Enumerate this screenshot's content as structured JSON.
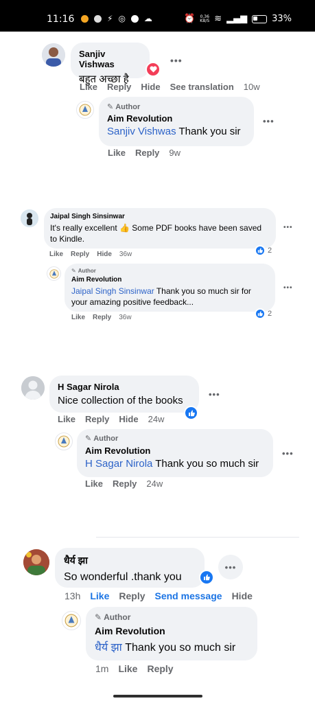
{
  "status_bar": {
    "time": "11:16",
    "net_speed_value": "0.36",
    "net_speed_unit": "KB/S",
    "battery": "33%"
  },
  "comments": [
    {
      "name": "Sanjiv Vishwas",
      "text": "बहुत अच्छा है",
      "reaction": "love",
      "actions": [
        "Like",
        "Reply",
        "Hide",
        "See translation"
      ],
      "time": "10w",
      "reply": {
        "tag": "Author",
        "name": "Aim Revolution",
        "mention": "Sanjiv Vishwas",
        "text": " Thank you sir",
        "actions": [
          "Like",
          "Reply"
        ],
        "time": "9w"
      }
    },
    {
      "name": "Jaipal Singh Sinsinwar",
      "text_line1": "It's really excellent 👍 Some PDF books have been saved",
      "text_line2": "to Kindle.",
      "reaction": "like",
      "reaction_count": "2",
      "actions": [
        "Like",
        "Reply",
        "Hide"
      ],
      "time": "36w",
      "reply": {
        "tag": "Author",
        "name": "Aim Revolution",
        "mention": "Jaipal Singh Sinsinwar",
        "text_line1": " Thank you so much sir for",
        "text_line2": "your amazing positive feedback...",
        "reaction_count": "2",
        "actions": [
          "Like",
          "Reply"
        ],
        "time": "36w"
      }
    },
    {
      "name": "H Sagar Nirola",
      "text": "Nice collection of the books",
      "reaction": "like",
      "actions": [
        "Like",
        "Reply",
        "Hide"
      ],
      "time": "24w",
      "reply": {
        "tag": "Author",
        "name": "Aim Revolution",
        "mention": "H Sagar Nirola",
        "text": " Thank you so much sir",
        "actions": [
          "Like",
          "Reply"
        ],
        "time": "24w"
      }
    },
    {
      "name": "धैर्य झा",
      "text": "So wonderful .thank you",
      "reaction": "like",
      "time": "13h",
      "actions": [
        "Like",
        "Reply",
        "Send message",
        "Hide"
      ],
      "reply": {
        "tag": "Author",
        "name": "Aim Revolution",
        "mention": "धैर्य झा",
        "text": " Thank you so much sir",
        "time": "1m",
        "actions": [
          "Like",
          "Reply"
        ]
      }
    }
  ],
  "colors": {
    "bubble": "#f0f2f5",
    "mention": "#2d63c8",
    "like_blue": "#1877f2",
    "love_red": "#f33e58",
    "meta_gray": "#65676b"
  },
  "icons": [
    "pencil-icon",
    "like-reaction-icon",
    "love-reaction-icon",
    "more-options-icon",
    "wifi-icon",
    "signal-icon",
    "battery-icon",
    "alarm-icon"
  ]
}
